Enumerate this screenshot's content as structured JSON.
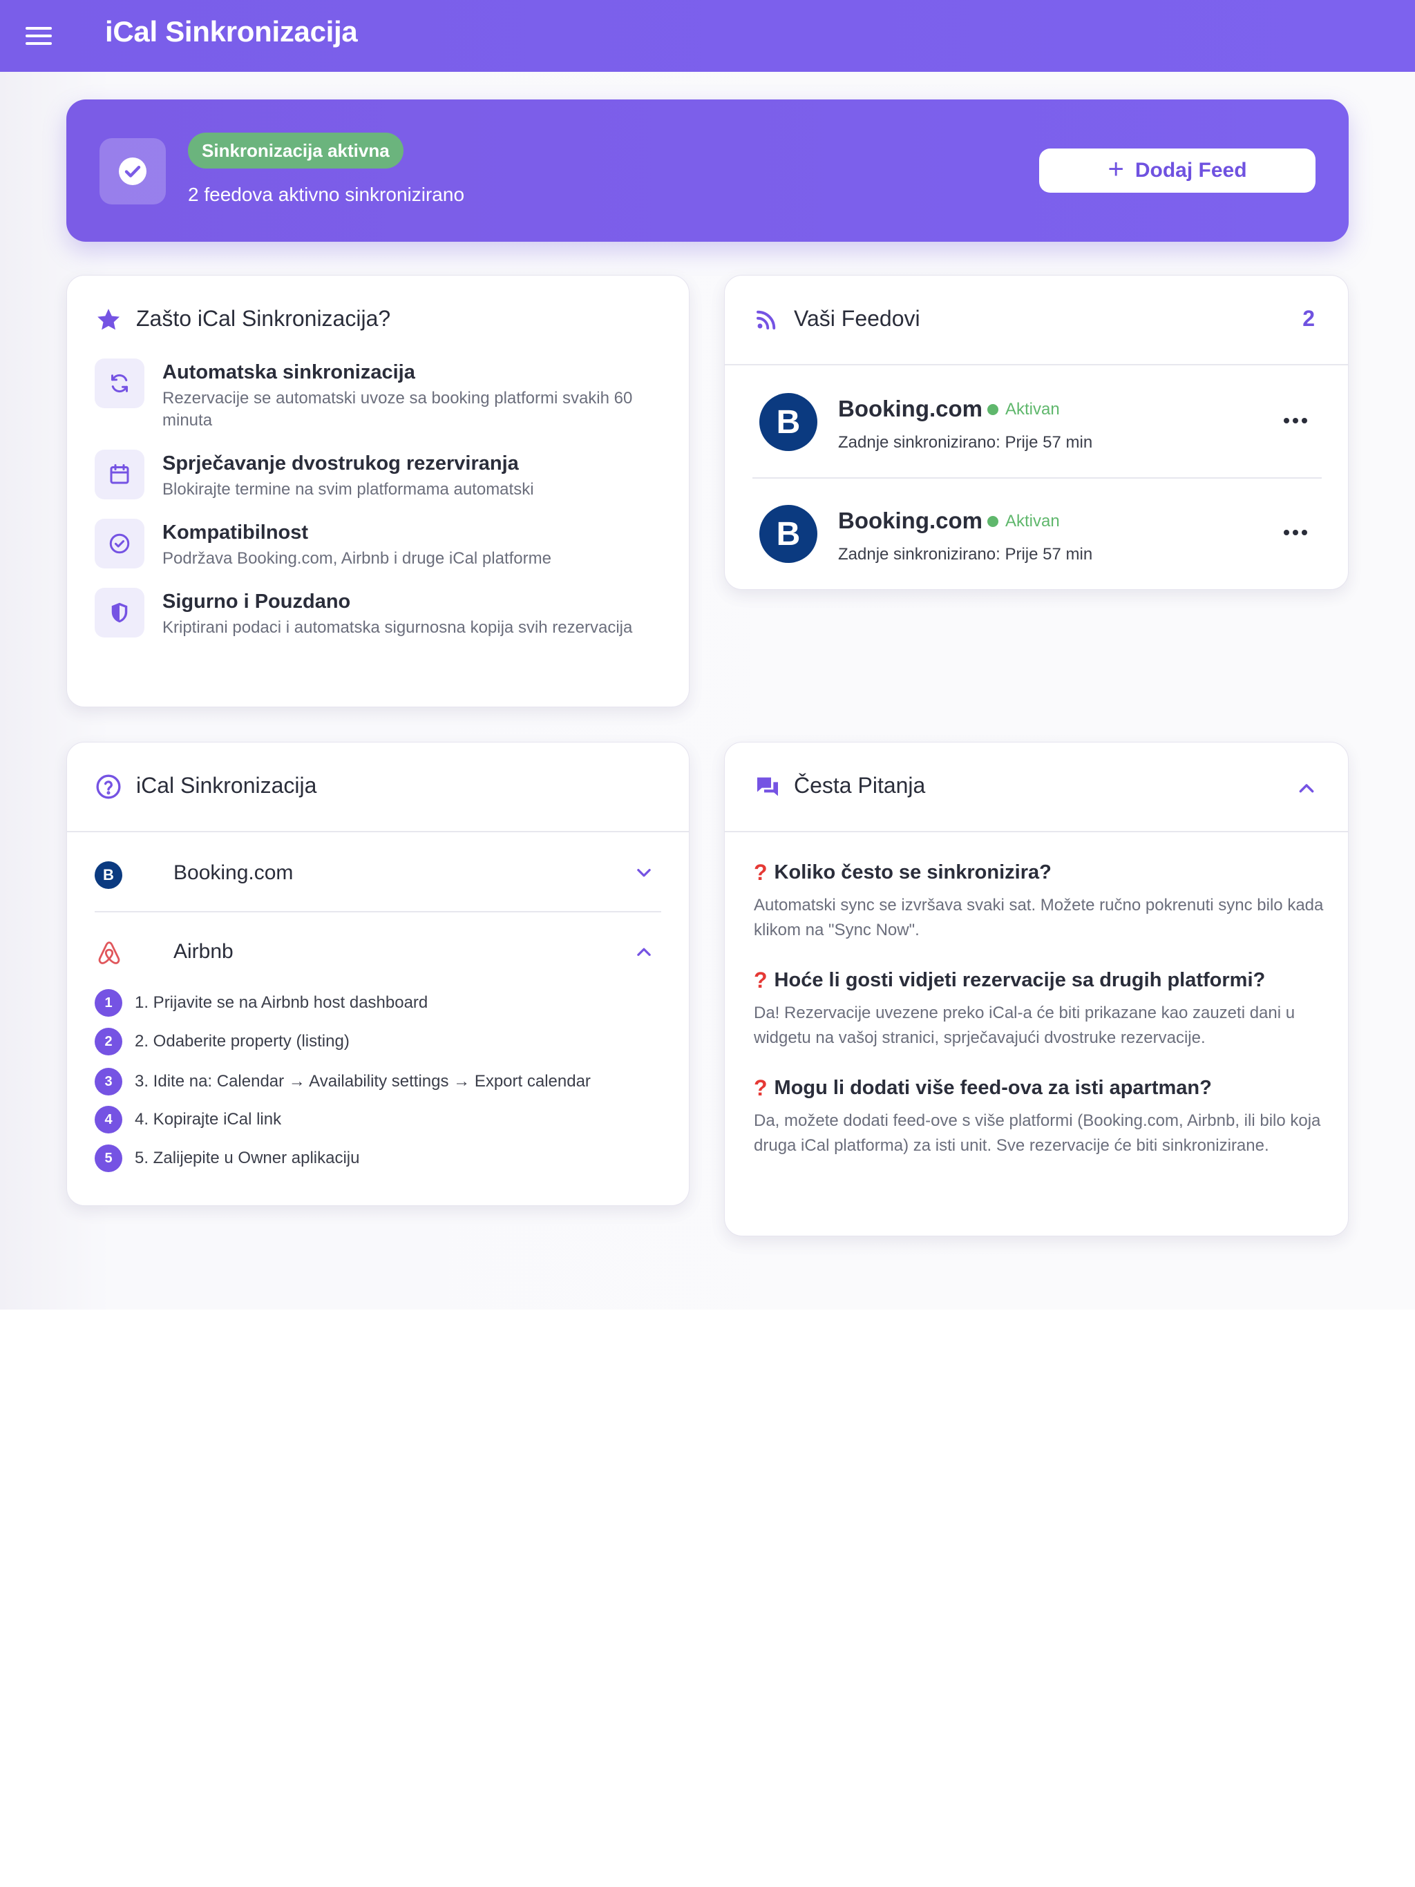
{
  "appbar": {
    "title": "iCal Sinkronizacija",
    "menu_icon": "menu-icon"
  },
  "banner": {
    "status_badge": "Sinkronizacija aktivna",
    "subtitle": "2 feedova aktivno sinkronizirano",
    "add_button_label": "Dodaj Feed",
    "icon": "check-circle-icon"
  },
  "why": {
    "title": "Zašto iCal Sinkronizacija?",
    "features": [
      {
        "title": "Automatska sinkronizacija",
        "desc": "Rezervacije se automatski uvoze sa booking platformi svakih 60 minuta",
        "icon": "sync-icon"
      },
      {
        "title": "Sprječavanje dvostrukog rezerviranja",
        "desc": "Blokirajte termine na svim platformama automatski",
        "icon": "calendar-icon"
      },
      {
        "title": "Kompatibilnost",
        "desc": "Podržava Booking.com, Airbnb i druge iCal platforme",
        "icon": "check-circle-icon"
      },
      {
        "title": "Sigurno i Pouzdano",
        "desc": "Kriptirani podaci i automatska sigurnosna kopija svih rezervacija",
        "icon": "shield-icon"
      }
    ]
  },
  "feeds": {
    "title": "Vaši Feedovi",
    "count": "2",
    "items": [
      {
        "logo": "B",
        "name": "Booking.com",
        "status": "Aktivan",
        "last_sync": "Zadnje sinkronizirano: Prije 57 min"
      },
      {
        "logo": "B",
        "name": "Booking.com",
        "status": "Aktivan",
        "last_sync": "Zadnje sinkronizirano: Prije 57 min"
      }
    ]
  },
  "ical": {
    "title": "iCal Sinkronizacija",
    "platforms": [
      {
        "logo": "B",
        "name": "Booking.com",
        "expanded": false
      },
      {
        "name": "Airbnb",
        "expanded": true
      }
    ],
    "steps": [
      {
        "num": "1",
        "text": "1. Prijavite se na Airbnb host dashboard"
      },
      {
        "num": "2",
        "text": "2. Odaberite property (listing)"
      },
      {
        "num": "3",
        "text": "3. Idite na: Calendar → Availability settings → Export calendar"
      },
      {
        "num": "4",
        "text": "4. Kopirajte iCal link"
      },
      {
        "num": "5",
        "text": "5. Zalijepite u Owner aplikaciju"
      }
    ]
  },
  "faq": {
    "title": "Česta Pitanja",
    "items": [
      {
        "q": "Koliko često se sinkronizira?",
        "a": "Automatski sync se izvršava svaki sat. Možete ručno pokrenuti sync bilo kada klikom na \"Sync Now\"."
      },
      {
        "q": "Hoće li gosti vidjeti rezervacije sa drugih platformi?",
        "a": "Da! Rezervacije uvezene preko iCal-a će biti prikazane kao zauzeti dani u widgetu na vašoj stranici, sprječavajući dvostruke rezervacije."
      },
      {
        "q": "Mogu li dodati više feed-ova za isti apartman?",
        "a": "Da, možete dodati feed-ove s više platformi (Booking.com, Airbnb, ili bilo koja druga iCal platforma) za isti unit. Sve rezervacije će biti sinkronizirane."
      }
    ]
  },
  "colors": {
    "accent": "#7b5ce6",
    "active_green": "#6bb47d",
    "booking_blue": "#0b3a80",
    "airbnb_red": "#e0565b"
  }
}
